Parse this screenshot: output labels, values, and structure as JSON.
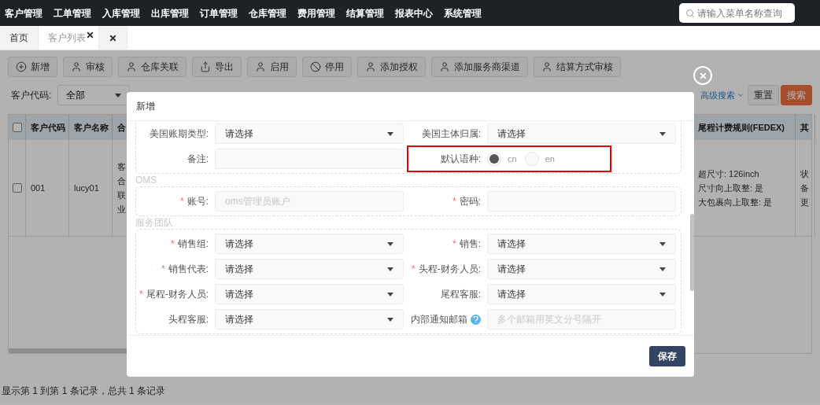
{
  "top_nav": {
    "menu": [
      "客户管理",
      "工单管理",
      "入库管理",
      "出库管理",
      "订单管理",
      "仓库管理",
      "费用管理",
      "结算管理",
      "报表中心",
      "系统管理"
    ],
    "search": {
      "placeholder": "请输入菜单名称查询"
    }
  },
  "tabs": [
    {
      "label": "首页",
      "selected": false,
      "closable": false
    },
    {
      "label": "客户列表",
      "selected": true,
      "closable": true
    },
    {
      "selected": false,
      "closable": true
    }
  ],
  "toolbar": [
    "新增",
    "审核",
    "仓库关联",
    "导出",
    "启用",
    "停用",
    "添加授权",
    "添加服务商渠道",
    "结算方式审核"
  ],
  "filters": {
    "customer_code": {
      "label": "客户代码:",
      "value": "全部"
    },
    "advanced_search": "高级搜索",
    "buttons": [
      {
        "label": "重置",
        "kind": "default"
      },
      {
        "label": "搜索",
        "kind": "primary"
      }
    ]
  },
  "table": {
    "header_checked": false,
    "columns": [
      "客户代码",
      "客户名称",
      "合",
      "尾程计费规则(FEDEX)",
      "其"
    ],
    "rows": [
      {
        "checked": false,
        "cells": [
          [
            "001"
          ],
          [
            "lucy01"
          ],
          [
            "客",
            "合",
            "联",
            "业"
          ],
          [
            "超尺寸: 126inch",
            "尺寸向上取整: 是",
            "大包裹向上取整: 是"
          ],
          [
            "状",
            "备",
            "更"
          ]
        ]
      }
    ]
  },
  "pagination_info": "显示第 1 到第 1 条记录，总共 1 条记录",
  "modal": {
    "title": "新增",
    "sections": [
      {
        "rows": [
          [
            {
              "kind": "select",
              "label": "美国账期类型:",
              "value": "请选择"
            },
            {
              "kind": "select",
              "label": "美国主体归属:",
              "value": "请选择"
            }
          ],
          [
            {
              "kind": "input",
              "label": "备注:"
            },
            {
              "kind": "radio",
              "label": "默认语种:",
              "highlighted": true,
              "options": [
                {
                  "label": "cn",
                  "selected": true
                },
                {
                  "label": "en",
                  "selected": false
                }
              ]
            }
          ]
        ]
      },
      {
        "title": "OMS",
        "rows": [
          [
            {
              "kind": "input",
              "label": "账号:",
              "required_mark": "*",
              "placeholder": "oms管理员账户"
            },
            {
              "kind": "input",
              "label": "密码:",
              "required_mark": "*"
            }
          ]
        ]
      },
      {
        "title": "服务团队",
        "rows": [
          [
            {
              "kind": "select",
              "label": "销售组:",
              "required_mark": "*",
              "value": "请选择"
            },
            {
              "kind": "select",
              "label": "销售:",
              "required_mark": "*",
              "value": "请选择"
            }
          ],
          [
            {
              "kind": "select",
              "label": "销售代表:",
              "required_mark": "*",
              "value": "请选择"
            },
            {
              "kind": "select",
              "label": "头程-财务人员:",
              "required_mark": "*",
              "value": "请选择"
            }
          ],
          [
            {
              "kind": "select",
              "label": "尾程-财务人员:",
              "required_mark": "*",
              "value": "请选择"
            },
            {
              "kind": "select",
              "label": "尾程客服:",
              "value": "请选择"
            }
          ],
          [
            {
              "kind": "select",
              "label": "头程客服:",
              "value": "请选择"
            },
            {
              "kind": "input",
              "label": "内部通知邮箱",
              "help": true,
              "placeholder": "多个邮箱用英文分号隔开"
            }
          ]
        ]
      }
    ],
    "save_button": "保存"
  }
}
